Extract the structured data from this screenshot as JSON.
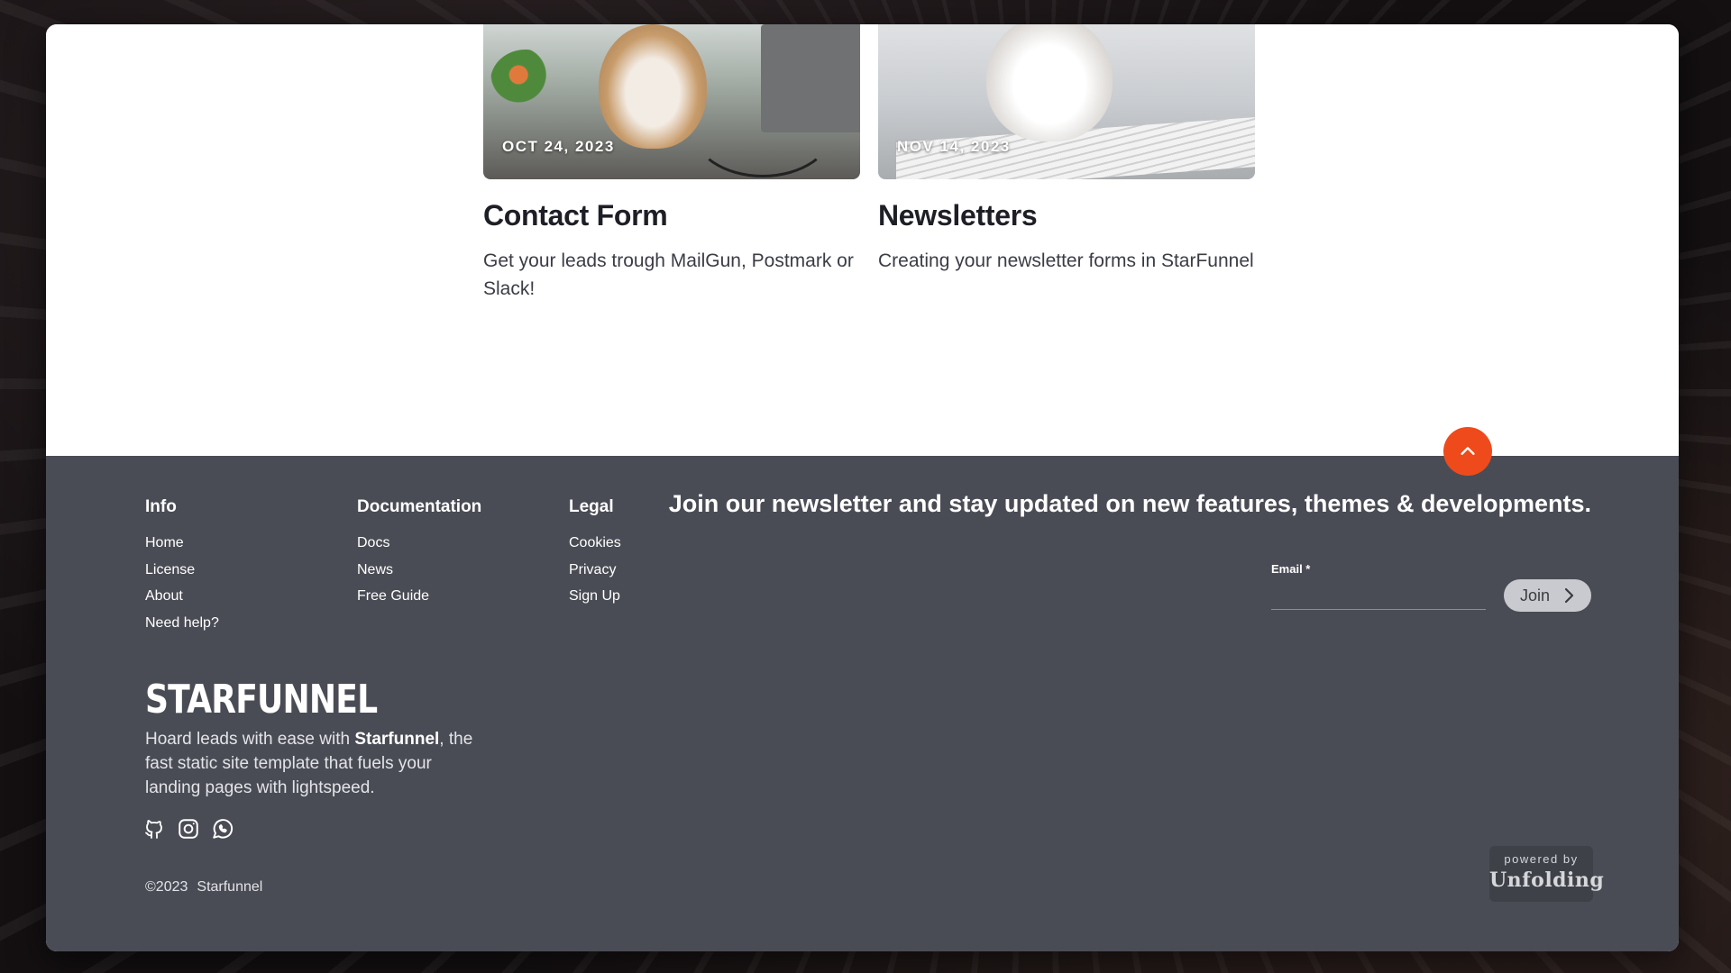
{
  "blog": {
    "posts": [
      {
        "date": "OCT 24, 2023",
        "title": "Contact Form",
        "excerpt": "Get your leads trough MailGun, Postmark or Slack!"
      },
      {
        "date": "NOV 14, 2023",
        "title": "Newsletters",
        "excerpt": "Creating your newsletter forms in StarFunnel"
      }
    ]
  },
  "footer": {
    "columns": [
      {
        "heading": "Info",
        "links": [
          "Home",
          "License",
          "About",
          "Need help?"
        ]
      },
      {
        "heading": "Documentation",
        "links": [
          "Docs",
          "News",
          "Free Guide"
        ]
      },
      {
        "heading": "Legal",
        "links": [
          "Cookies",
          "Privacy",
          "Sign Up"
        ]
      }
    ],
    "brand": "STARFUNNEL",
    "tagline": {
      "before": "Hoard leads with ease with ",
      "bold": "Starfunnel",
      "after": ", the fast static site template that fuels your landing pages with lightspeed."
    },
    "social_icons": [
      "github-icon",
      "instagram-icon",
      "whatsapp-icon"
    ],
    "copyright": {
      "year": "©2023",
      "name": "Starfunnel"
    },
    "newsletter": {
      "title_bold": "Join our newsletter",
      "title_rest": " and stay updated on new features, themes & developments.",
      "email_label": "Email *",
      "email_value": "",
      "join_label": "Join"
    },
    "powered_by": {
      "line1": "powered by",
      "line2": "Unfolding"
    }
  },
  "colors": {
    "accent": "#ef4a1c",
    "footer_bg": "#4a4c55",
    "text_dark": "#1e1f26"
  },
  "icons": {
    "scroll_top": "chevron-up-icon",
    "join_arrow": "chevron-right-icon"
  }
}
